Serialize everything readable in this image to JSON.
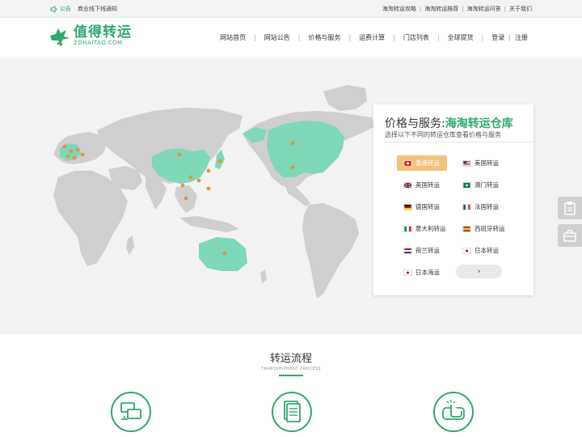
{
  "topbar": {
    "notice_tag": "公告",
    "notice_text": "商业线下线通知",
    "links": [
      "海淘转运攻略",
      "海淘转运推荐",
      "海淘转运问答",
      "关于我们"
    ]
  },
  "header": {
    "logo_cn": "值得转运",
    "logo_en": "ZDHAITAO.COM",
    "nav": [
      "网站首页",
      "网站公告",
      "价格与服务",
      "运费计算",
      "门店列表",
      "全球提货"
    ],
    "login": "登录",
    "register": "注册"
  },
  "panel": {
    "title_prefix": "价格与服务:",
    "title_highlight": "海淘转运仓库",
    "subtitle": "选择以下不同的转运仓库查看价格与服务",
    "options": [
      {
        "label": "香港转运",
        "flag": "hk",
        "active": true
      },
      {
        "label": "美国转运",
        "flag": "us"
      },
      {
        "label": "英国转运",
        "flag": "uk"
      },
      {
        "label": "澳门转运",
        "flag": "mo"
      },
      {
        "label": "德国转运",
        "flag": "de"
      },
      {
        "label": "法国转运",
        "flag": "fr"
      },
      {
        "label": "意大利转运",
        "flag": "it"
      },
      {
        "label": "西班牙转运",
        "flag": "es"
      },
      {
        "label": "荷兰转运",
        "flag": "nl"
      },
      {
        "label": "日本转运",
        "flag": "jp"
      },
      {
        "label": "日本海运",
        "flag": "jp"
      }
    ],
    "next_symbol": "›"
  },
  "process": {
    "title": "转运流程",
    "subtitle": "TRANSSHIPMENT PROCESS"
  },
  "colors": {
    "brand": "#2fa96a",
    "highlight_region": "#7fd8b8",
    "land": "#cfcfcf",
    "marker": "#e0944a",
    "active_option": "#f3c37c"
  },
  "icons": [
    "speaker-icon",
    "clipboard-icon",
    "bag-icon",
    "computer-transfer-icon",
    "document-icon",
    "hand-click-icon",
    "chevron-right-icon"
  ]
}
